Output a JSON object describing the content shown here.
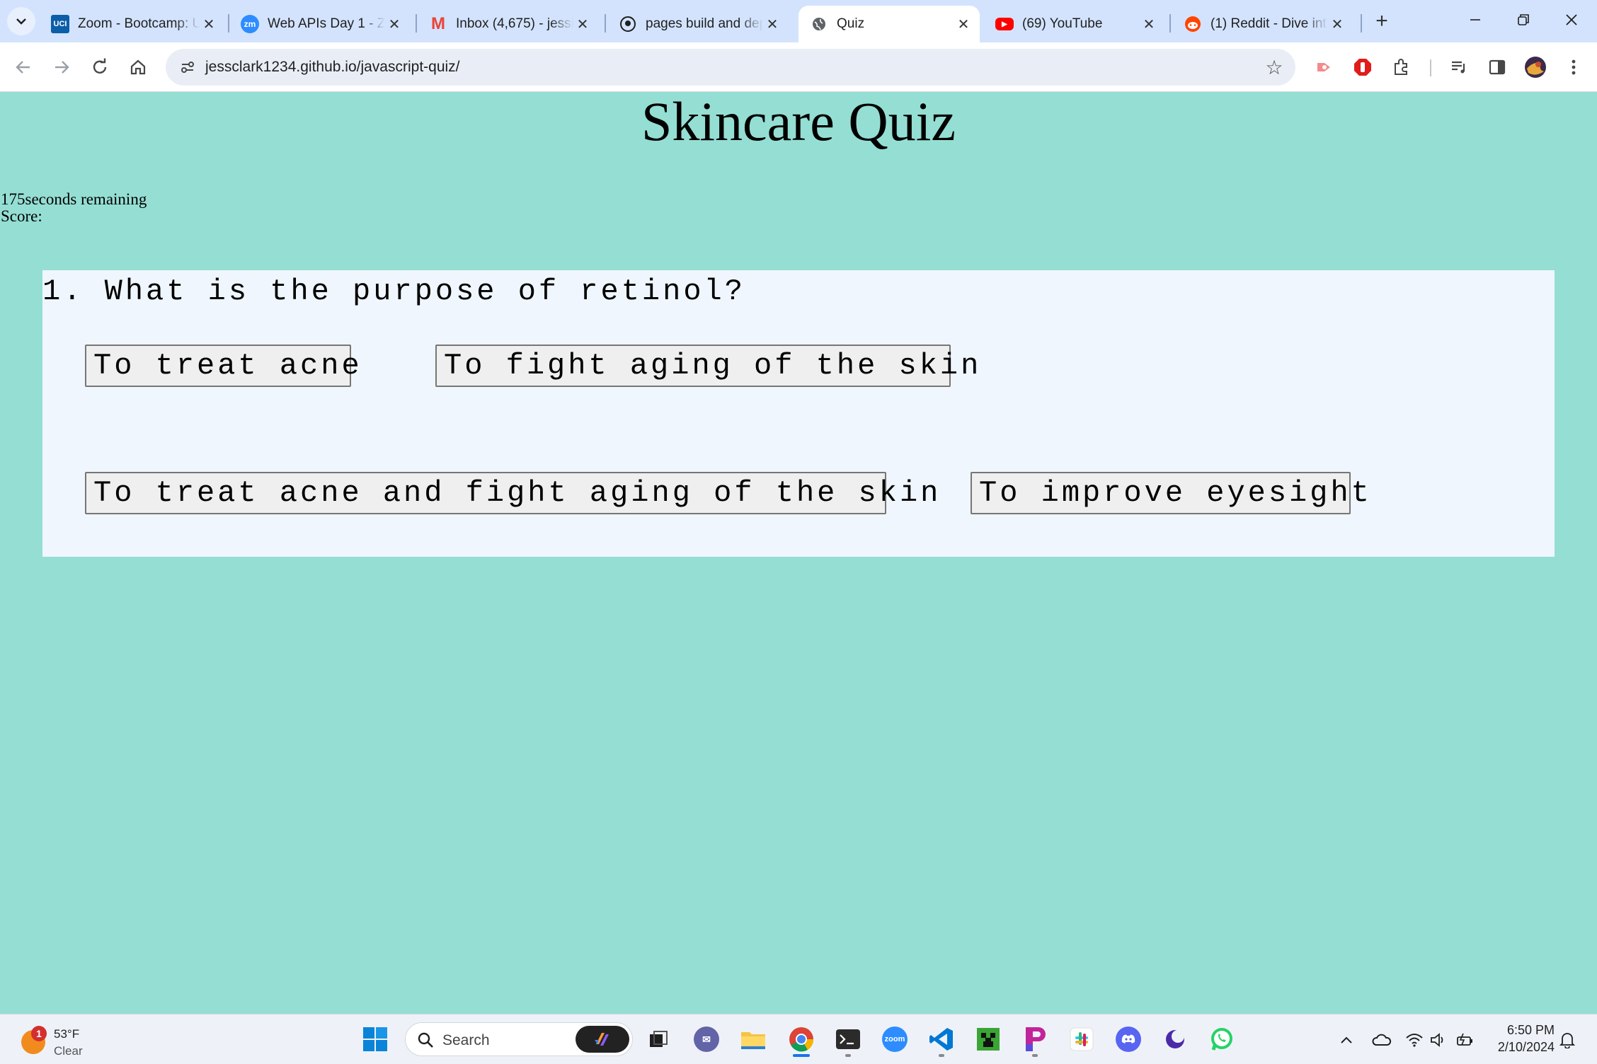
{
  "browser": {
    "tabs": [
      {
        "title": "Zoom - Bootcamp: U",
        "favicon": "uci-icon",
        "favicon_text": "UCI",
        "favicon_color": "#0b5ea8"
      },
      {
        "title": "Web APIs Day 1 - Zo",
        "favicon": "zoom-icon",
        "favicon_text": "zm",
        "favicon_color": "#2d8cff"
      },
      {
        "title": "Inbox (4,675) - jessic",
        "favicon": "gmail-icon",
        "favicon_text": "M",
        "favicon_color": "#ea4335"
      },
      {
        "title": "pages build and dep",
        "favicon": "github-icon",
        "favicon_text": "",
        "favicon_color": "#1f1f1f"
      },
      {
        "title": "Quiz",
        "favicon": "globe-icon",
        "favicon_text": "",
        "favicon_color": "#5f6368",
        "active": true
      },
      {
        "title": "(69) YouTube",
        "favicon": "youtube-icon",
        "favicon_text": "▶",
        "favicon_color": "#ff0000"
      },
      {
        "title": "(1) Reddit - Dive int",
        "favicon": "reddit-icon",
        "favicon_text": "",
        "favicon_color": "#ff4500"
      }
    ],
    "url": "jessclark1234.github.io/javascript-quiz/"
  },
  "quiz": {
    "heading": "Skincare Quiz",
    "timer_text": "175seconds remaining",
    "score_label": "Score:",
    "question": "1. What is the purpose of retinol?",
    "answers": [
      "To treat acne",
      "To fight aging of the skin",
      "To treat acne and fight aging of the skin",
      "To improve eyesight"
    ]
  },
  "taskbar": {
    "weather": {
      "temp": "53°F",
      "condition": "Clear",
      "badge": "1"
    },
    "search_placeholder": "Search",
    "clock_time": "6:50 PM",
    "clock_date": "2/10/2024"
  },
  "colors": {
    "page_bg": "#95ded3",
    "card_bg": "#eff6fd",
    "button_bg": "#efefef",
    "tabstrip_bg": "#d3e3fd"
  }
}
